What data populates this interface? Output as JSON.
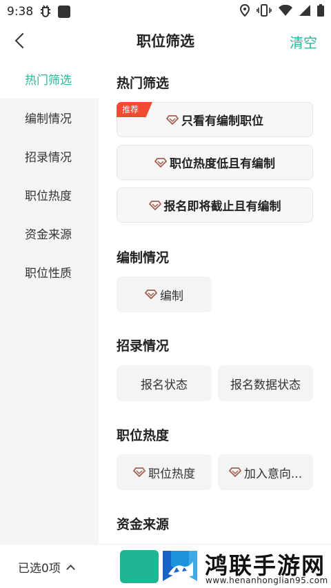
{
  "status_bar": {
    "time": "9:38",
    "icons": [
      "bug-icon",
      "app-square-icon",
      "location-icon",
      "vibrate-icon",
      "wifi-icon",
      "signal-icon",
      "battery-icon"
    ]
  },
  "header": {
    "title": "职位筛选",
    "clear_label": "清空"
  },
  "sidebar": {
    "items": [
      {
        "label": "热门筛选",
        "active": true
      },
      {
        "label": "编制情况",
        "active": false
      },
      {
        "label": "招录情况",
        "active": false
      },
      {
        "label": "职位热度",
        "active": false
      },
      {
        "label": "资金来源",
        "active": false
      },
      {
        "label": "职位性质",
        "active": false
      }
    ]
  },
  "sections": {
    "hot": {
      "title": "热门筛选",
      "tag": "推荐",
      "chips": [
        "只看有编制职位",
        "职位热度低且有编制",
        "报名即将截止且有编制"
      ]
    },
    "bianzhi": {
      "title": "编制情况",
      "chips": [
        "编制"
      ]
    },
    "zhaolu": {
      "title": "招录情况",
      "chips": [
        "报名状态",
        "报名数据状态"
      ]
    },
    "redu": {
      "title": "职位热度",
      "chips": [
        "职位热度",
        "加入意向..."
      ]
    },
    "zijin": {
      "title": "资金来源"
    }
  },
  "footer": {
    "selected_label": "已选0项"
  },
  "watermark": {
    "text": "鸿联手游网",
    "url": "www.henanhonglian95.com"
  },
  "colors": {
    "accent": "#2bb89a",
    "tag": "#f04a33",
    "confirm": "#21b595",
    "diamond": "#a0614f"
  }
}
